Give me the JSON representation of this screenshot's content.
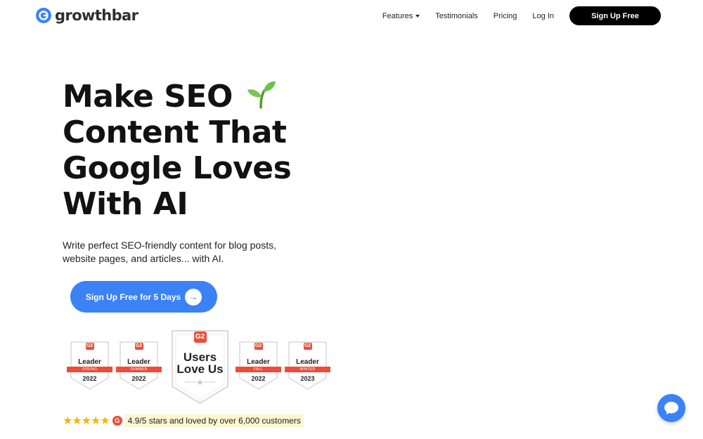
{
  "colors": {
    "accent": "#3b82f6",
    "g2_red": "#ef4b38",
    "nav_cta_bg": "#000000",
    "star": "#f5b50a",
    "highlight": "#fdf6cf"
  },
  "brand": {
    "name": "growthbar",
    "logo_icon": "growthbar-logo-icon"
  },
  "nav": {
    "features": "Features",
    "testimonials": "Testimonials",
    "pricing": "Pricing",
    "login": "Log In",
    "signup": "Sign Up Free"
  },
  "hero": {
    "title_lines": [
      "Make SEO",
      "Content That",
      "Google Loves",
      "With AI"
    ],
    "title_emoji_icon": "seedling-icon",
    "subtitle": "Write perfect SEO-friendly content for blog posts, website pages, and articles... with AI.",
    "cta": "Sign Up Free for 5 Days",
    "cta_icon": "arrow-right-icon"
  },
  "badges": [
    {
      "g2": "G2",
      "title": "Leader",
      "season": "SPRING",
      "year": "2022"
    },
    {
      "g2": "G2",
      "title": "Leader",
      "season": "SUMMER",
      "year": "2022"
    },
    {
      "g2": "G2",
      "title_line1": "Users",
      "title_line2": "Love Us"
    },
    {
      "g2": "G2",
      "title": "Leader",
      "season": "FALL",
      "year": "2022"
    },
    {
      "g2": "G2",
      "title": "Leader",
      "season": "WINTER",
      "year": "2023"
    }
  ],
  "rating": {
    "stars": "★★★★★",
    "star_count": 5,
    "g2": "G",
    "text": "4.9/5 stars and loved by over 6,000 customers"
  },
  "chat": {
    "icon": "chat-bubble-icon"
  }
}
